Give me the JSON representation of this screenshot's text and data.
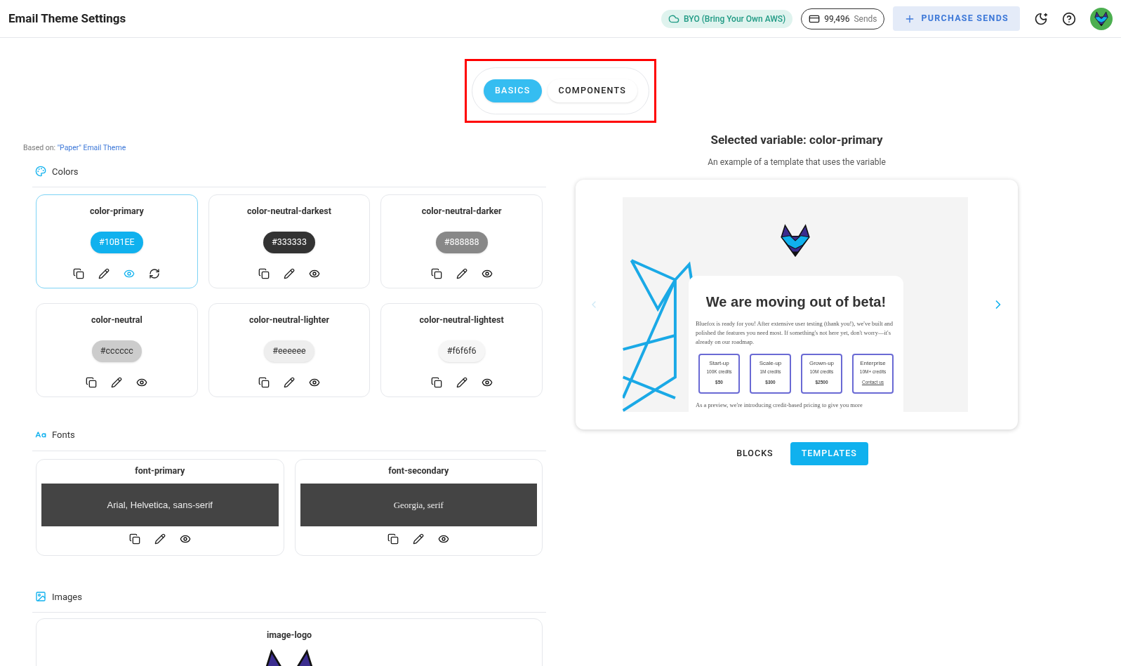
{
  "header": {
    "title": "Email Theme Settings",
    "byo_badge": "BYO (Bring Your Own AWS)",
    "sends_count": "99,496",
    "sends_label": "Sends",
    "purchase_button": "PURCHASE SENDS"
  },
  "mode_tabs": [
    {
      "label": "BASICS",
      "selected": true
    },
    {
      "label": "COMPONENTS",
      "selected": false
    }
  ],
  "based_on": {
    "label": "Based on:",
    "link": "\"Paper\" Email Theme"
  },
  "colors": {
    "title": "Colors",
    "items": [
      {
        "name": "color-primary",
        "value": "#10B1EE",
        "color": "#10b1ee",
        "selected": true
      },
      {
        "name": "color-neutral-darkest",
        "value": "#333333",
        "color": "#333333",
        "selected": false
      },
      {
        "name": "color-neutral-darker",
        "value": "#888888",
        "color": "#888888",
        "selected": false
      },
      {
        "name": "color-neutral",
        "value": "#cccccc",
        "color": "#cccccc",
        "selected": false
      },
      {
        "name": "color-neutral-lighter",
        "value": "#eeeeee",
        "color": "#eeeeee",
        "selected": false
      },
      {
        "name": "color-neutral-lightest",
        "value": "#f6f6f6",
        "color": "#f6f6f6",
        "selected": false
      }
    ]
  },
  "fonts": {
    "title": "Fonts",
    "items": [
      {
        "name": "font-primary",
        "sample": "Arial, Helvetica, sans-serif",
        "kind": "sans"
      },
      {
        "name": "font-secondary",
        "sample": "Georgia, serif",
        "kind": "serif"
      }
    ]
  },
  "images": {
    "title": "Images",
    "items": [
      {
        "name": "image-logo"
      }
    ]
  },
  "preview": {
    "title": "Selected variable: color-primary",
    "subtitle": "An example of a template that uses the variable",
    "email": {
      "heading": "We are moving out of beta!",
      "body": "Bluefox is ready for you! After extensive user testing (thank you!), we've built and polished the features you need most. If something's not here yet, don't worry—it's already on our roadmap.",
      "plans": [
        {
          "name": "Start-up",
          "credits": "100K credits",
          "price": "$50",
          "kind": "price"
        },
        {
          "name": "Scale-up",
          "credits": "1M credits",
          "price": "$300",
          "kind": "price"
        },
        {
          "name": "Grown-up",
          "credits": "10M credits",
          "price": "$2500",
          "kind": "price"
        },
        {
          "name": "Enterprise",
          "credits": "10M+ credits",
          "price": "Contact us",
          "kind": "link"
        }
      ],
      "footer": "As a preview, we're introducing credit-based pricing to give you more"
    },
    "prev_disabled": true
  },
  "view_tabs": [
    {
      "label": "BLOCKS",
      "selected": false
    },
    {
      "label": "TEMPLATES",
      "selected": true
    }
  ]
}
